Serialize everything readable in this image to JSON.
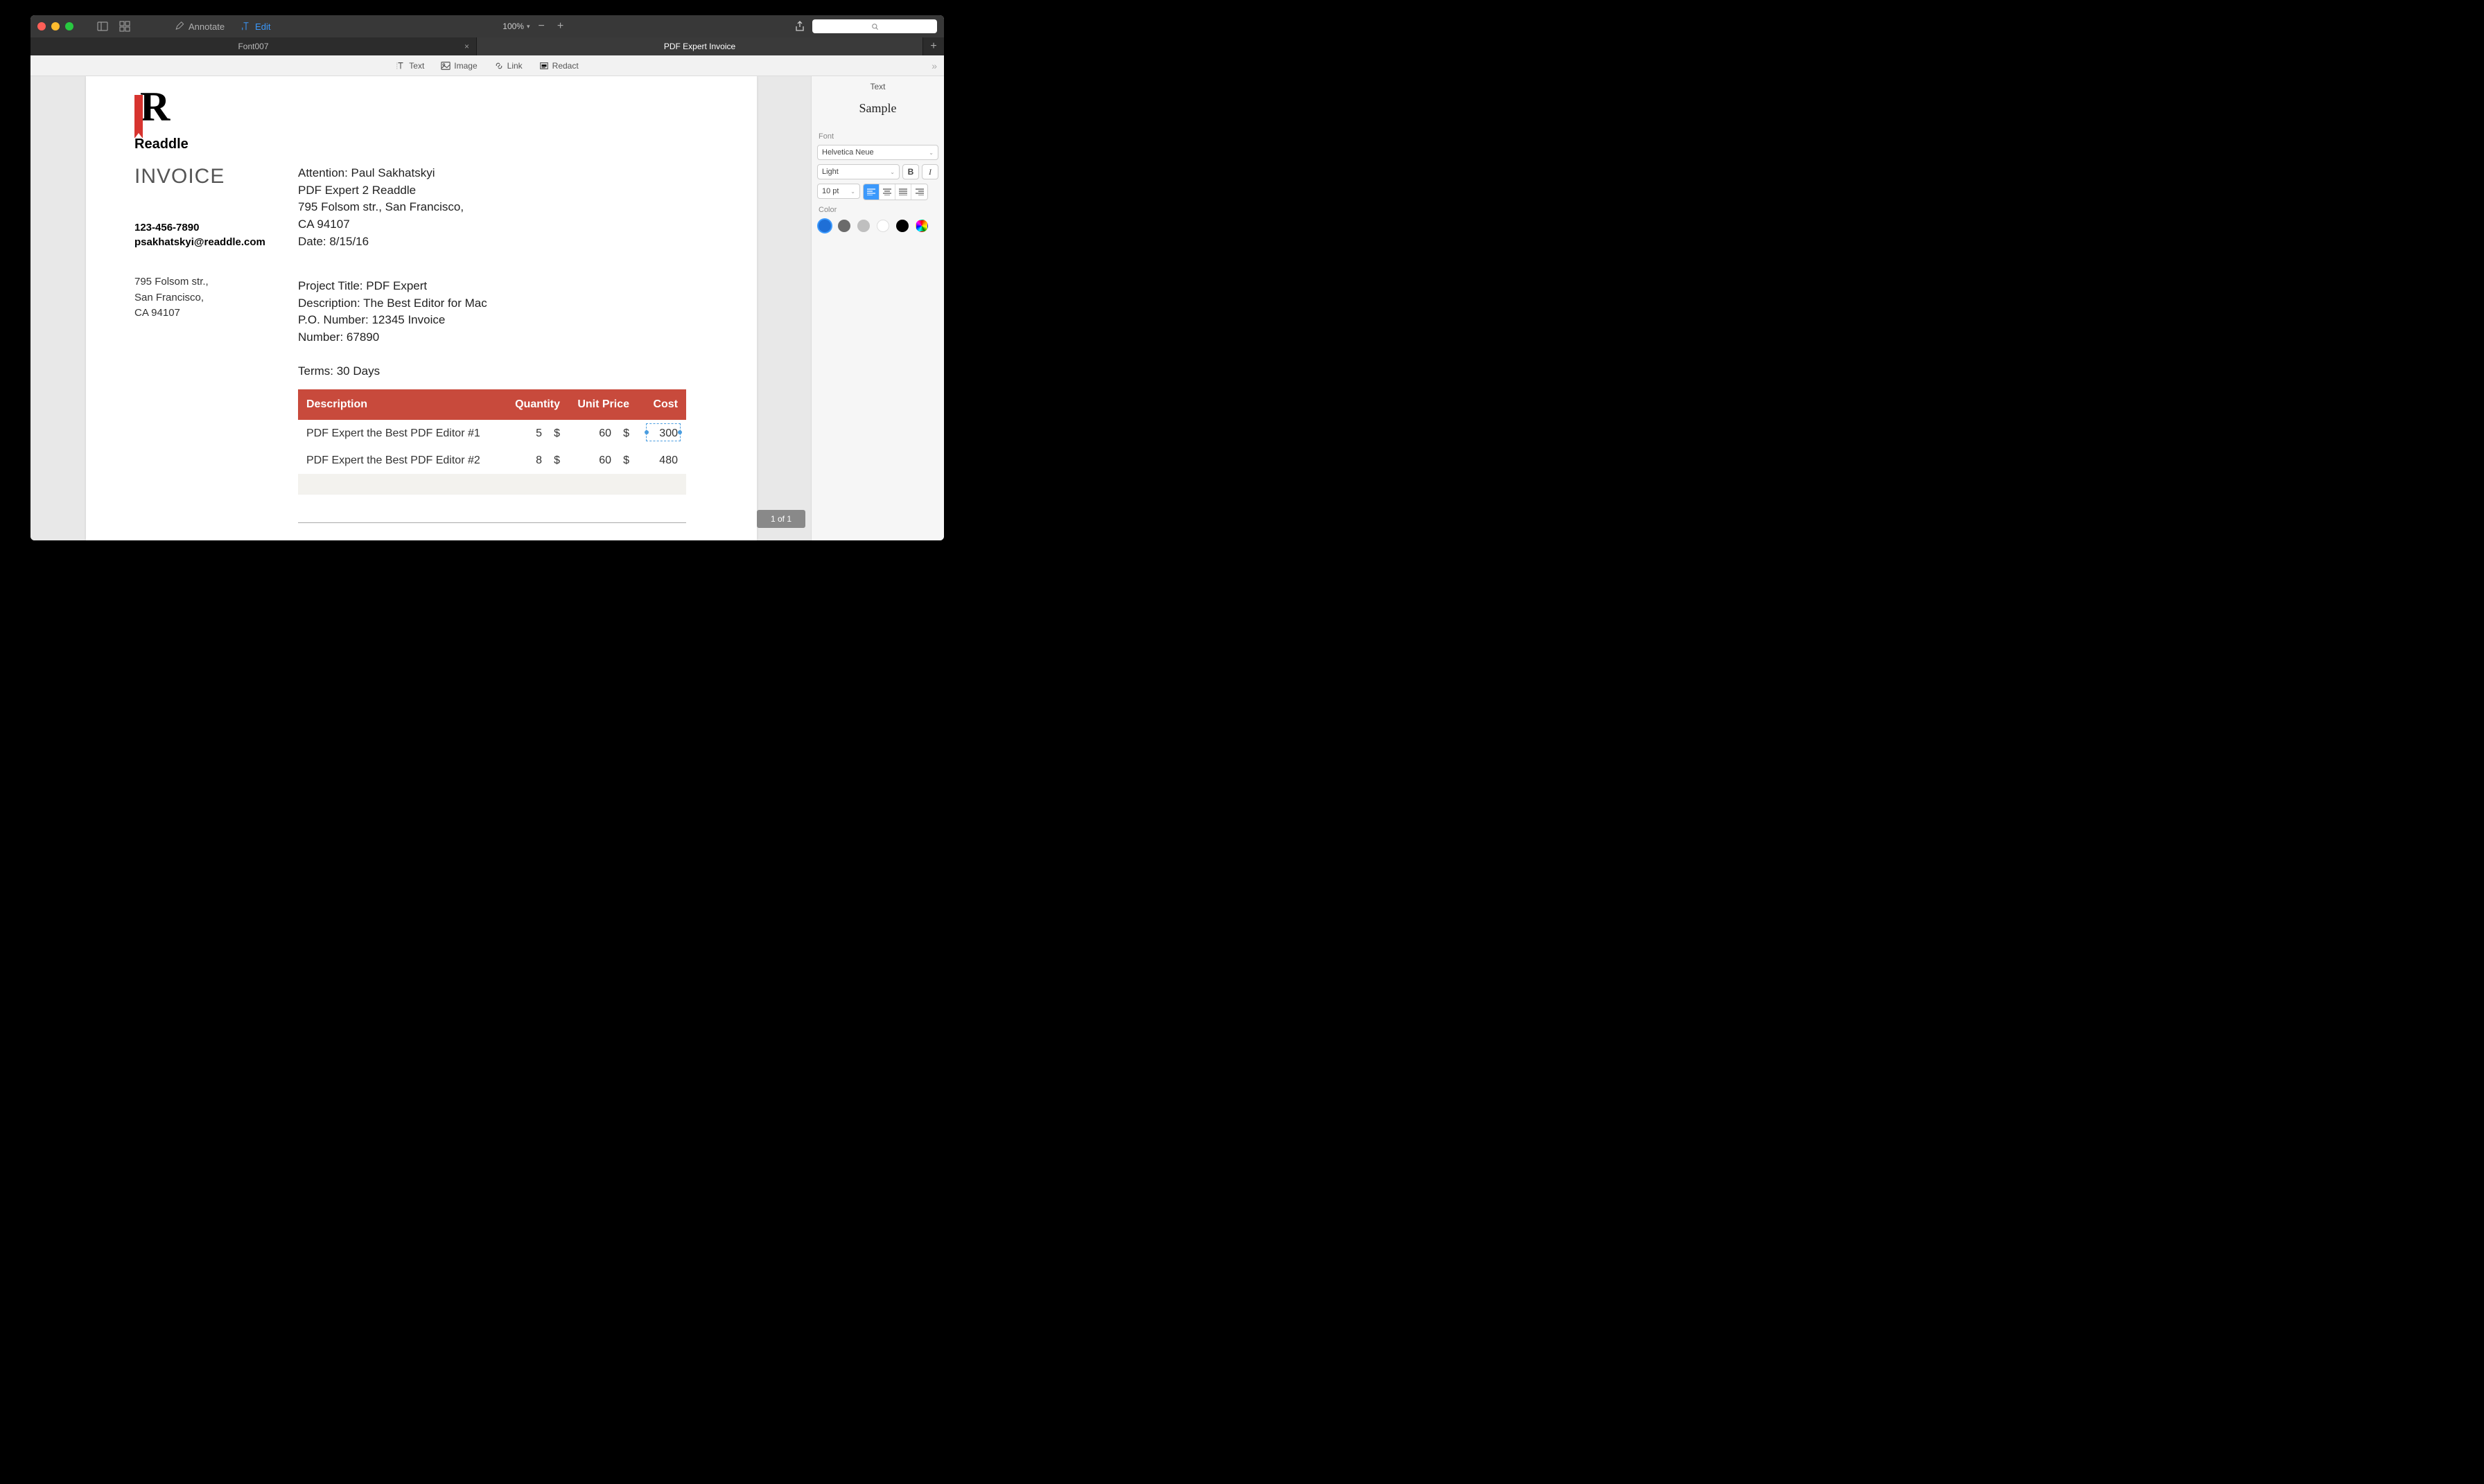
{
  "titlebar": {
    "annotate": "Annotate",
    "edit": "Edit",
    "zoom": "100%"
  },
  "tabs": {
    "tab1": "Font007",
    "tab2": "PDF Expert Invoice"
  },
  "tools": {
    "text": "Text",
    "image": "Image",
    "link": "Link",
    "redact": "Redact"
  },
  "invoice": {
    "company": "Readdle",
    "heading": "INVOICE",
    "phone": "123-456-7890",
    "email": "psakhatskyi@readdle.com",
    "addr1": "795 Folsom str.,",
    "addr2": "San Francisco,",
    "addr3": "CA 94107",
    "attn1": "Attention: Paul Sakhatskyi",
    "attn2": "PDF Expert 2 Readdle",
    "attn3": "795 Folsom str., San Francisco,",
    "attn4": "CA 94107",
    "attn5": "Date: 8/15/16",
    "proj1": "Project Title: PDF Expert",
    "proj2": "Description: The Best Editor for Mac",
    "proj3": "P.O. Number: 12345 Invoice",
    "proj4": "Number: 67890",
    "terms": "Terms: 30 Days",
    "th_desc": "Description",
    "th_qty": "Quantity",
    "th_up": "Unit Price",
    "th_cost": "Cost",
    "r1_desc": "PDF Expert the Best PDF Editor #1",
    "r1_qty": "5",
    "r1_cur": "$",
    "r1_up": "60",
    "r1_cost": "300",
    "r2_desc": "PDF Expert the Best PDF Editor #2",
    "r2_qty": "8",
    "r2_cur": "$",
    "r2_up": "60",
    "r2_cost": "480"
  },
  "page_indicator": "1 of 1",
  "sidebar": {
    "title": "Text",
    "sample": "Sample",
    "font_label": "Font",
    "font_family": "Helvetica Neue",
    "font_weight": "Light",
    "font_size": "10 pt",
    "bold": "B",
    "italic": "I",
    "color_label": "Color"
  }
}
